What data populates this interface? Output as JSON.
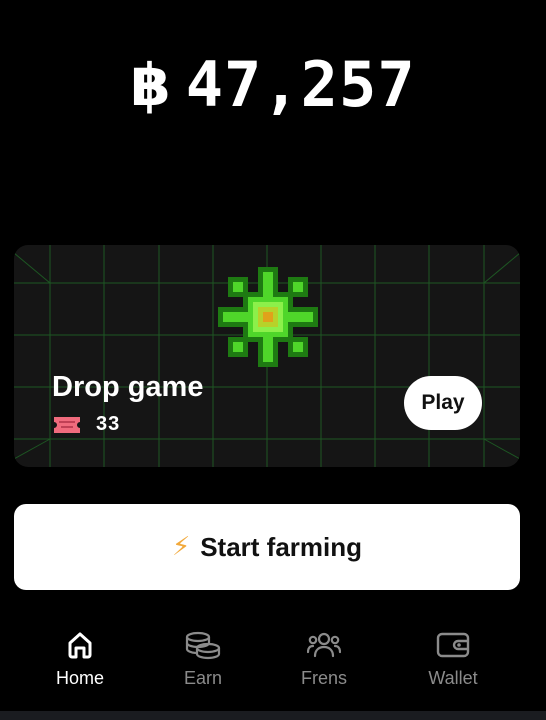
{
  "balance": {
    "currency_symbol": "฿",
    "amount": "47,257"
  },
  "game_card": {
    "title": "Drop game",
    "ticket_count": "33",
    "play_label": "Play"
  },
  "farm_button": {
    "label": "Start farming"
  },
  "nav": {
    "items": [
      {
        "label": "Home",
        "icon": "home-icon",
        "active": true
      },
      {
        "label": "Earn",
        "icon": "coins-icon",
        "active": false
      },
      {
        "label": "Frens",
        "icon": "friends-icon",
        "active": false
      },
      {
        "label": "Wallet",
        "icon": "wallet-icon",
        "active": false
      }
    ]
  },
  "colors": {
    "background": "#000000",
    "card": "#151515",
    "grid_line": "#1f6b2a",
    "clover_green": "#4fd62a",
    "bolt": "#f2a93b",
    "ticket": "#f06b7d",
    "nav_inactive": "#8b8b8b"
  }
}
